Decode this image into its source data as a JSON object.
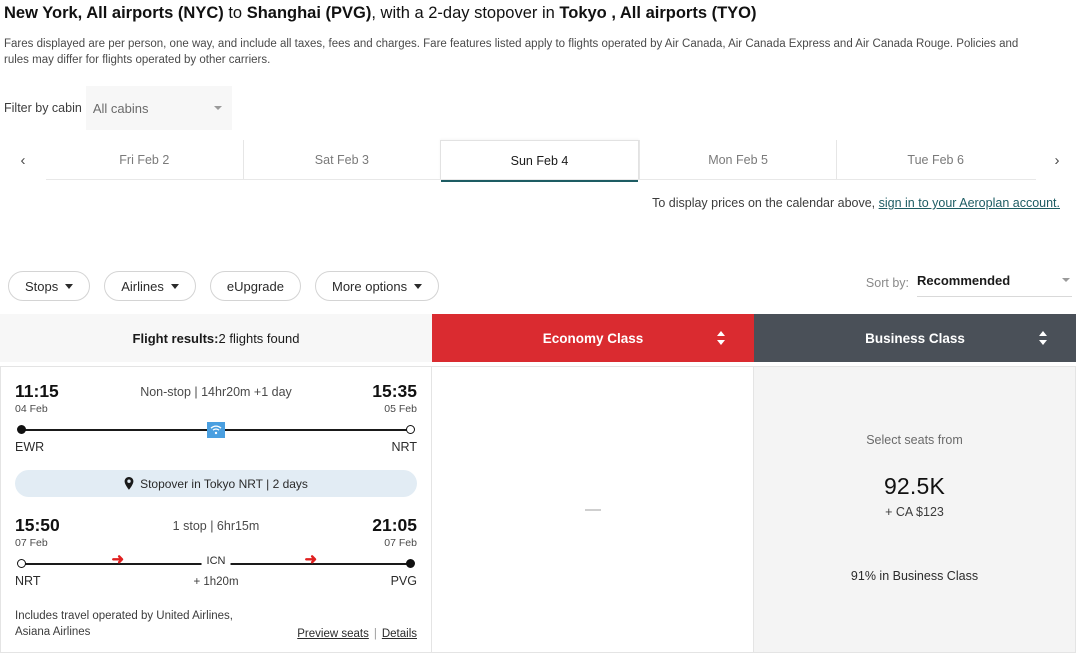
{
  "heading": {
    "origin": "New York, All airports (NYC)",
    "connector_to": " to ",
    "destination": "Shanghai (PVG)",
    "middle": ", with a 2-day stopover in ",
    "stopover_city": "Tokyo , All airports (TYO)"
  },
  "disclaimer": "Fares displayed are per person, one way, and include all taxes, fees and charges. Fare features listed apply to flights operated by Air Canada, Air Canada Express and Air Canada Rouge. Policies and rules may differ for flights operated by other carriers.",
  "cabin_filter": {
    "label": "Filter by cabin",
    "value": "All cabins"
  },
  "date_bar": {
    "prev_icon": "chevron-left-icon",
    "next_icon": "chevron-right-icon",
    "prev_glyph": "‹",
    "next_glyph": "›",
    "tabs": [
      {
        "label": "Fri Feb 2",
        "active": false
      },
      {
        "label": "Sat Feb 3",
        "active": false
      },
      {
        "label": "Sun Feb 4",
        "active": true
      },
      {
        "label": "Mon Feb 5",
        "active": false
      },
      {
        "label": "Tue Feb 6",
        "active": false
      }
    ]
  },
  "signin": {
    "text": "To display prices on the calendar above, ",
    "link": "sign in to your Aeroplan account."
  },
  "filters": [
    {
      "label": "Stops",
      "has_caret": true
    },
    {
      "label": "Airlines",
      "has_caret": true
    },
    {
      "label": "eUpgrade",
      "has_caret": false
    },
    {
      "label": "More options",
      "has_caret": true
    }
  ],
  "sort": {
    "label": "Sort by:",
    "value": "Recommended"
  },
  "columns": {
    "results_label": "Flight results:",
    "results_count": "2 flights found",
    "economy": "Economy Class",
    "business": "Business Class"
  },
  "colors": {
    "economy_header": "#DA2B30",
    "business_header": "#4A5058",
    "active_tab_underline": "#1D5C63",
    "link": "#1D5C63",
    "stopover_pill": "#E2ECF4",
    "wifi_badge": "#4A9FE0",
    "stop_marker": "#E02020"
  },
  "flight": {
    "segment1": {
      "depart_time": "11:15",
      "depart_date": "04 Feb",
      "arrive_time": "15:35",
      "arrive_date": "05 Feb",
      "summary": "Non-stop | 14hr20m +1 day",
      "origin_code": "EWR",
      "destination_code": "NRT",
      "amenity_icon": "wifi-icon"
    },
    "stopover": {
      "icon": "map-pin-icon",
      "text": "Stopover in Tokyo NRT | 2 days"
    },
    "segment2": {
      "depart_time": "15:50",
      "depart_date": "07 Feb",
      "arrive_time": "21:05",
      "arrive_date": "07 Feb",
      "summary": "1 stop | 6hr15m",
      "origin_code": "NRT",
      "destination_code": "PVG",
      "stop_code": "ICN",
      "layover": "+ 1h20m"
    },
    "footnote": {
      "text": "Includes travel operated by United Airlines, Asiana Airlines",
      "preview_seats": "Preview seats",
      "separator": "|",
      "details": "Details"
    },
    "economy_fare": {
      "available": false,
      "placeholder": "—"
    },
    "business_fare": {
      "select_label": "Select seats from",
      "points": "92.5K",
      "cash": "+ CA $123",
      "availability": "91% in Business Class"
    }
  }
}
